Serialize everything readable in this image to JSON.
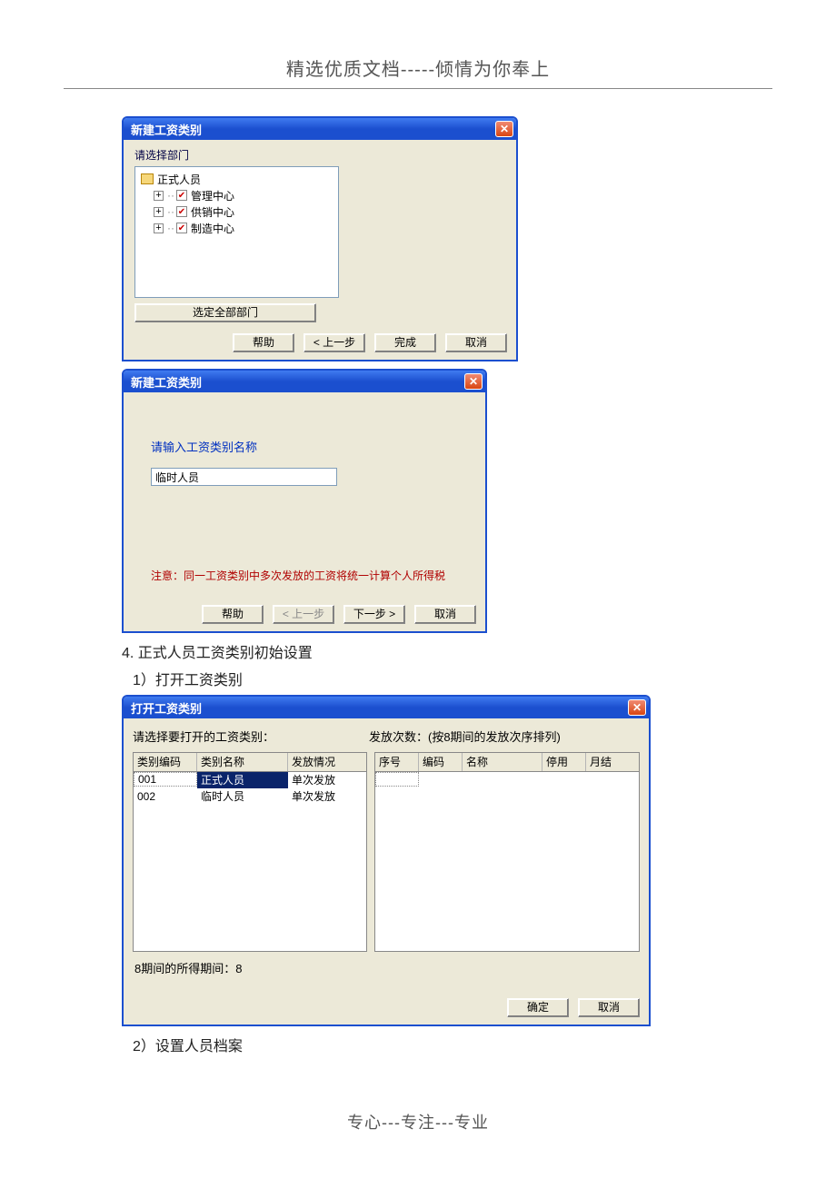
{
  "doc": {
    "header": "精选优质文档-----倾情为你奉上",
    "footer": "专心---专注---专业",
    "section4": "4. 正式人员工资类别初始设置",
    "step1": "1）打开工资类别",
    "step2": "2）设置人员档案"
  },
  "dialog1": {
    "title": "新建工资类别",
    "prompt": "请选择部门",
    "tree": {
      "root": "正式人员",
      "children": [
        "管理中心",
        "供销中心",
        "制造中心"
      ]
    },
    "select_all": "选定全部部门",
    "buttons": {
      "help": "帮助",
      "back": "< 上一步",
      "finish": "完成",
      "cancel": "取消"
    }
  },
  "dialog2": {
    "title": "新建工资类别",
    "prompt": "请输入工资类别名称",
    "input_value": "临时人员",
    "notice": "注意：同一工资类别中多次发放的工资将统一计算个人所得税",
    "buttons": {
      "help": "帮助",
      "back": "< 上一步",
      "next": "下一步 >",
      "cancel": "取消"
    }
  },
  "dialog3": {
    "title": "打开工资类别",
    "prompt_left": "请选择要打开的工资类别：",
    "prompt_right": "发放次数：(按8期间的发放次序排列)",
    "left_headers": [
      "类别编码",
      "类别名称",
      "发放情况"
    ],
    "left_rows": [
      {
        "code": "001",
        "name": "正式人员",
        "mode": "单次发放",
        "selected": true
      },
      {
        "code": "002",
        "name": "临时人员",
        "mode": "单次发放",
        "selected": false
      }
    ],
    "right_headers": [
      "序号",
      "编码",
      "名称",
      "停用",
      "月结"
    ],
    "status": "8期间的所得期间：8",
    "buttons": {
      "ok": "确定",
      "cancel": "取消"
    }
  }
}
